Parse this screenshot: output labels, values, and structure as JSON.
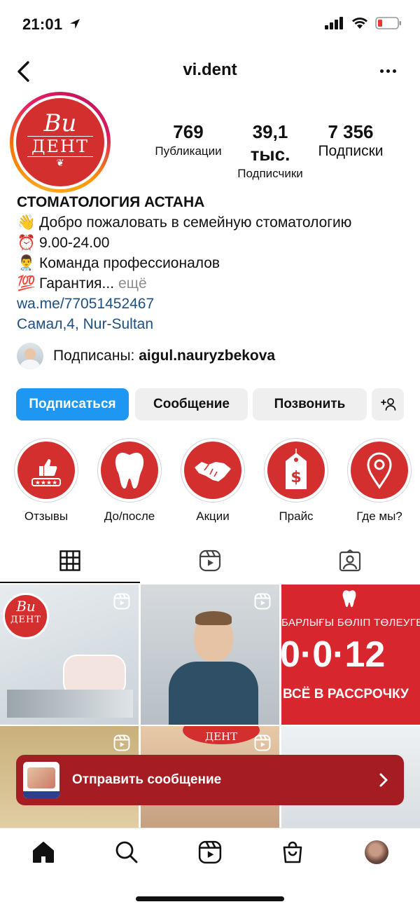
{
  "status_bar": {
    "time": "21:01"
  },
  "header": {
    "username": "vi.dent"
  },
  "profile": {
    "avatar_logo": {
      "script": "Ви",
      "name": "ДЕНТ"
    },
    "stats": [
      {
        "value": "769",
        "label": "Публикации"
      },
      {
        "value": "39,1 тыс.",
        "label": "Подписчики"
      },
      {
        "value": "7 356",
        "label": "Подписки"
      }
    ],
    "bio": {
      "name": "СТОМАТОЛОГИЯ АСТАНА",
      "lines": [
        {
          "emoji": "👋",
          "text": "Добро пожаловать в семейную стоматологию"
        },
        {
          "emoji": "⏰",
          "text": "9.00-24.00"
        },
        {
          "emoji": "👨‍⚕️",
          "text": "Команда профессионалов"
        },
        {
          "emoji": "💯",
          "text": "Гарантия..."
        }
      ],
      "more": "ещё",
      "link": "wa.me/77051452467",
      "location": "Самал,4, Nur-Sultan"
    },
    "followed_by": {
      "prefix": "Подписаны: ",
      "user": "aigul.nauryzbekova"
    }
  },
  "actions": {
    "follow": "Подписаться",
    "message": "Сообщение",
    "call": "Позвонить"
  },
  "highlights": [
    {
      "label": "Отзывы",
      "icon": "review-thumbs-up-icon"
    },
    {
      "label": "До/после",
      "icon": "tooth-icon"
    },
    {
      "label": "Акции",
      "icon": "handshake-icon"
    },
    {
      "label": "Прайс",
      "icon": "price-tag-icon"
    },
    {
      "label": "Где мы?",
      "icon": "location-pin-icon"
    }
  ],
  "grid": {
    "post3_top": "БАРЛЫҒЫ БӨЛІП ТӨЛЕУГЕ",
    "post3_big": "0·0·12",
    "post3_bottom": "ВСЁ В РАССРОЧКУ",
    "post5_logo": "ДЕНТ"
  },
  "toast": {
    "text": "Отправить сообщение"
  },
  "colors": {
    "accent_blue": "#1e97f2",
    "brand_red": "#d32f2f",
    "toast_red": "#a51d22"
  }
}
